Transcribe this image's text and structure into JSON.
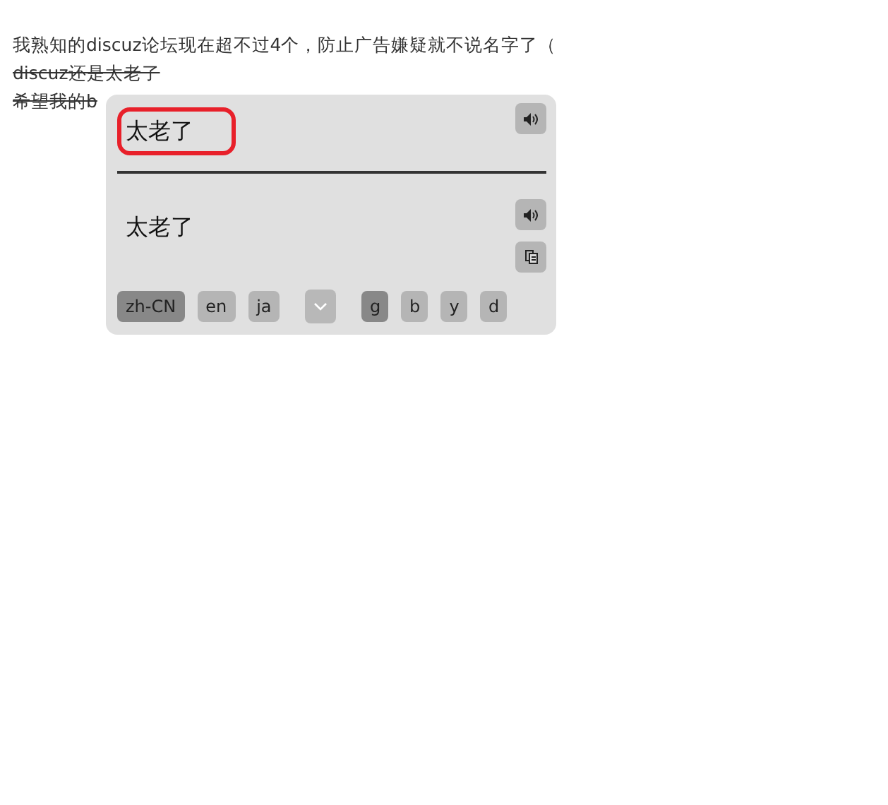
{
  "article": {
    "lines": [
      {
        "text": "我熟知的discuz论坛现在超不过4个，防止广告嫌疑就不说名字了（",
        "struck": false
      },
      {
        "text": "discuz还是太老了",
        "struck": true
      },
      {
        "text": "希望我的b",
        "struck": true
      }
    ]
  },
  "translate_popup": {
    "source_text": "太老了",
    "source_highlighted": true,
    "translation": "太老了",
    "languages": [
      {
        "label": "zh-CN",
        "selected": true
      },
      {
        "label": "en",
        "selected": false
      },
      {
        "label": "ja",
        "selected": false
      }
    ],
    "engines": [
      {
        "label": "g",
        "selected": true
      },
      {
        "label": "b",
        "selected": false
      },
      {
        "label": "y",
        "selected": false
      },
      {
        "label": "d",
        "selected": false
      }
    ]
  }
}
